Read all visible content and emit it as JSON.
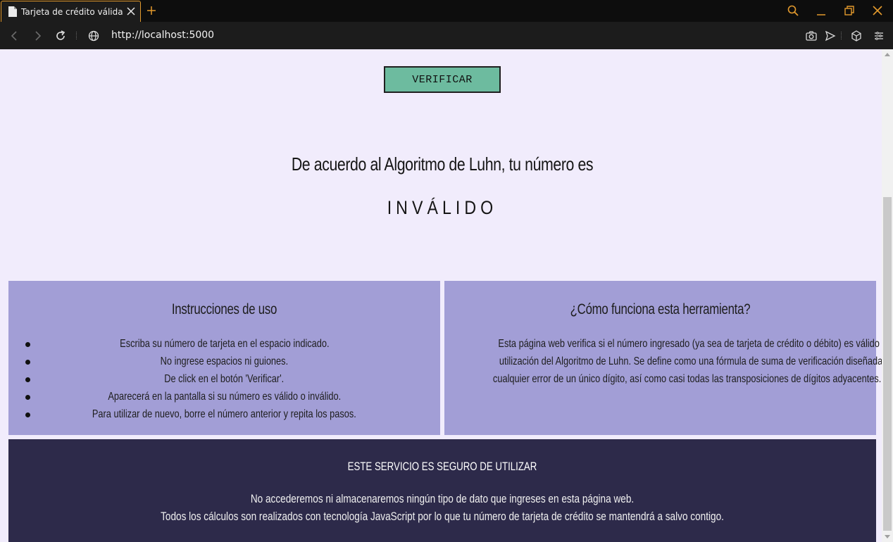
{
  "browser": {
    "tab_title": "Tarjeta de crédito válida",
    "url": "http://localhost:5000",
    "accent_color": "#e39a2d"
  },
  "page": {
    "verify_button": "VERIFICAR",
    "result_prefix": "De acuerdo al Algoritmo de Luhn, tu número es",
    "result_status": "INVÁLIDO",
    "instructions": {
      "title": "Instrucciones de uso",
      "items": [
        "Escriba su número de tarjeta en el espacio indicado.",
        "No ingrese espacios ni guiones.",
        "De click en el botón 'Verificar'.",
        "Aparecerá en la pantalla si su número es válido o inválido.",
        "Para utilizar de nuevo, borre el número anterior y repita los pasos."
      ]
    },
    "how_it_works": {
      "title": "¿Cómo funciona esta herramienta?",
      "lines": [
        "Esta página web verifica si el número ingresado (ya sea de tarjeta de crédito o débito) es válido mediante la",
        "utilización del Algoritmo de Luhn. Se define como una fórmula de suma de verificación diseñada para detectar",
        "cualquier error de un único dígito, así como casi todas las transposiciones de dígitos adyacentes."
      ]
    },
    "security": {
      "title": "ESTE SERVICIO ES SEGURO DE UTILIZAR",
      "line1": "No accederemos ni almacenaremos ningún tipo de dato que ingreses en esta página web.",
      "line2": "Todos los cálculos son realizados con tecnología JavaScript por lo que tu número de tarjeta de crédito se mantendrá a salvo contigo."
    },
    "colors": {
      "background": "#f1ecfc",
      "button": "#6dbb9f",
      "card": "#a29ed6",
      "footer": "#2d2a4a"
    }
  }
}
